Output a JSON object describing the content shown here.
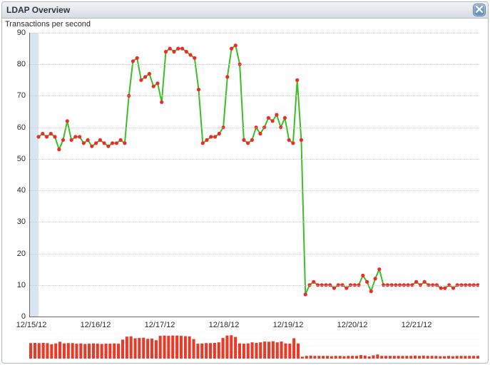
{
  "panel": {
    "title": "LDAP Overview",
    "subtitle": "Transactions per second",
    "title_extra": "",
    "close_hint": "Close"
  },
  "axes": {
    "y": {
      "min": 0,
      "max": 90,
      "ticks": [
        0,
        10,
        20,
        30,
        40,
        50,
        60,
        70,
        80,
        90
      ]
    },
    "x": {
      "categories": [
        "12/15/12",
        "12/16/12",
        "12/17/12",
        "12/18/12",
        "12/19/12",
        "12/20/12",
        "12/21/12"
      ]
    }
  },
  "colors": {
    "line": "#3bbd24",
    "point": "#ef2a2a",
    "thumb_bar": "#e63b28",
    "thumb_grid": "#d7b4b0",
    "highlight": "#c2d3e7"
  },
  "chart_data": {
    "type": "line",
    "title": "LDAP Overview",
    "subtitle": "Transactions per second",
    "xlabel": "",
    "ylabel": "",
    "ylim": [
      0,
      90
    ],
    "x_categories": [
      "12/15/12",
      "12/16/12",
      "12/17/12",
      "12/18/12",
      "12/19/12",
      "12/20/12",
      "12/21/12"
    ],
    "series": [
      {
        "name": "tps",
        "values": [
          57,
          58,
          57,
          58,
          57,
          53,
          56,
          62,
          56,
          57,
          57,
          55,
          56,
          54,
          55,
          56,
          55,
          54,
          55,
          55,
          56,
          55,
          70,
          81,
          82,
          75,
          76,
          77,
          73,
          74,
          68,
          84,
          85,
          84,
          85,
          85,
          84,
          83,
          82,
          72,
          55,
          56,
          57,
          57,
          58,
          60,
          76,
          85,
          86,
          80,
          56,
          55,
          56,
          60,
          58,
          60,
          63,
          62,
          64,
          60,
          63,
          56,
          55,
          75,
          56,
          7,
          10,
          11,
          10,
          10,
          10,
          10,
          9,
          10,
          10,
          9,
          10,
          10,
          10,
          13,
          11,
          8,
          12,
          15,
          10,
          10,
          10,
          10,
          10,
          10,
          10,
          10,
          11,
          10,
          11,
          10,
          10,
          10,
          9,
          9,
          10,
          9,
          10,
          10,
          10,
          10,
          10,
          10
        ]
      }
    ]
  }
}
